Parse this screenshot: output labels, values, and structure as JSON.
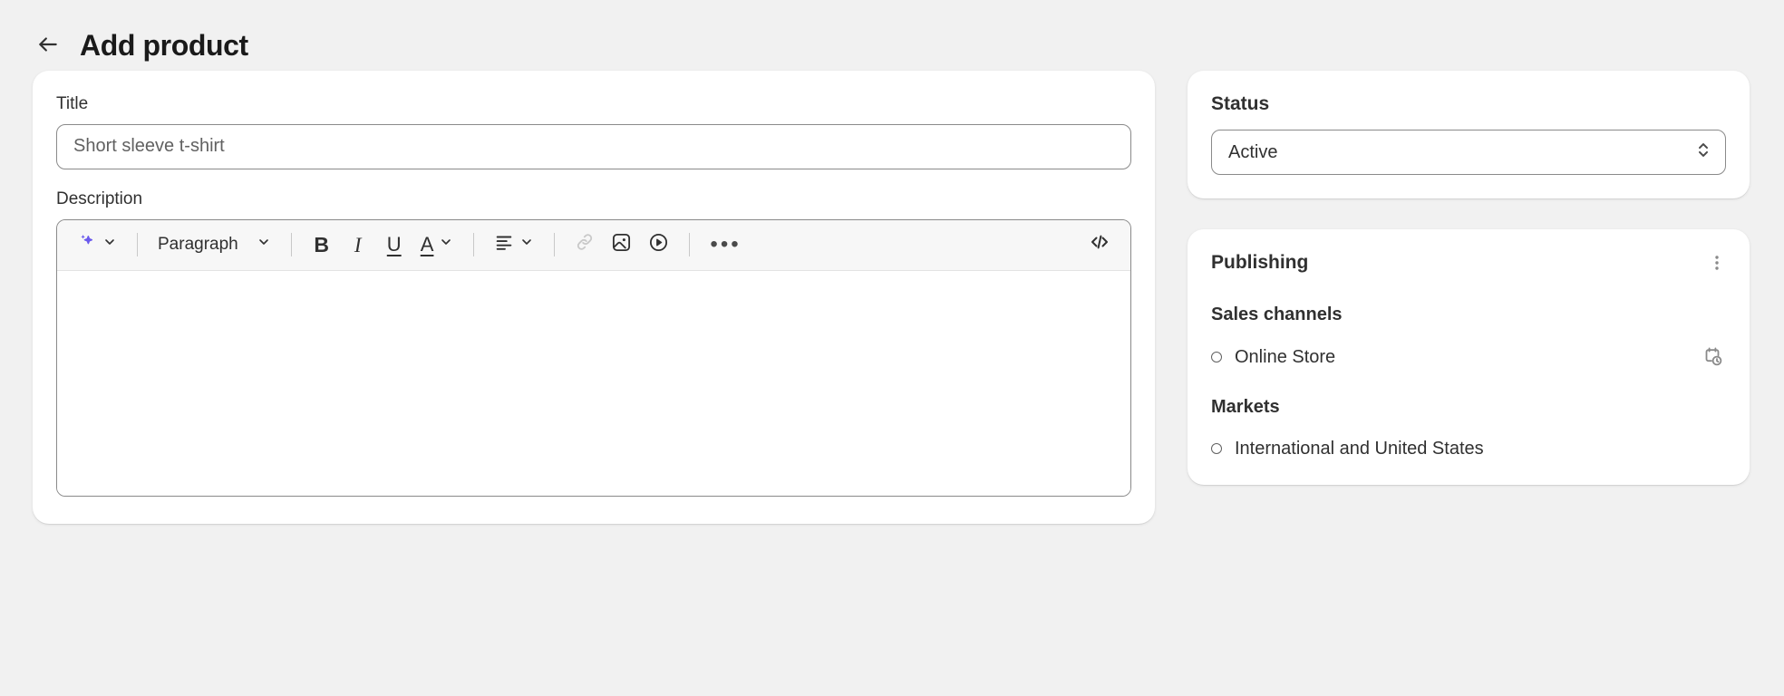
{
  "header": {
    "back_icon": "arrow-left-icon",
    "title": "Add product"
  },
  "main": {
    "title_field": {
      "label": "Title",
      "value": "",
      "placeholder": "Short sleeve t-shirt"
    },
    "description_field": {
      "label": "Description",
      "value": "",
      "toolbar": {
        "ai_assist": {
          "icon": "sparkle-icon",
          "chevron": "chevron-down-icon"
        },
        "block_style": {
          "label": "Paragraph",
          "chevron": "chevron-down-icon"
        },
        "bold": {
          "label": "B",
          "icon": "bold-icon"
        },
        "italic": {
          "label": "I",
          "icon": "italic-icon"
        },
        "underline": {
          "label": "U",
          "icon": "underline-icon"
        },
        "text_color": {
          "label": "A",
          "icon": "text-color-icon",
          "chevron": "chevron-down-icon"
        },
        "align": {
          "icon": "align-left-icon",
          "chevron": "chevron-down-icon"
        },
        "link": {
          "icon": "link-icon",
          "state": "disabled"
        },
        "image": {
          "icon": "image-icon"
        },
        "video": {
          "icon": "video-play-icon"
        },
        "more": {
          "icon": "ellipsis-icon",
          "label": "•••"
        },
        "code_view": {
          "icon": "code-icon",
          "label": "</>"
        }
      }
    }
  },
  "sidebar": {
    "status_card": {
      "heading": "Status",
      "select_value": "Active",
      "select_icon": "chevron-up-down-icon"
    },
    "publishing_card": {
      "heading": "Publishing",
      "menu_icon": "kebab-menu-icon",
      "sections": [
        {
          "subheading": "Sales channels",
          "items": [
            {
              "label": "Online Store",
              "bullet": "circle-bullet-icon",
              "action_icon": "calendar-clock-icon"
            }
          ]
        },
        {
          "subheading": "Markets",
          "items": [
            {
              "label": "International and United States",
              "bullet": "circle-bullet-icon",
              "action_icon": null
            }
          ]
        }
      ]
    }
  },
  "colors": {
    "page_background": "#F1F1F1",
    "card_background": "#FFFFFF",
    "text_primary": "#303030",
    "text_secondary": "#616161",
    "border": "#8A8A8A",
    "toolbar_background": "#F7F7F7",
    "ai_accent": "#6B5AED",
    "disabled_icon": "#C9C9C9"
  }
}
